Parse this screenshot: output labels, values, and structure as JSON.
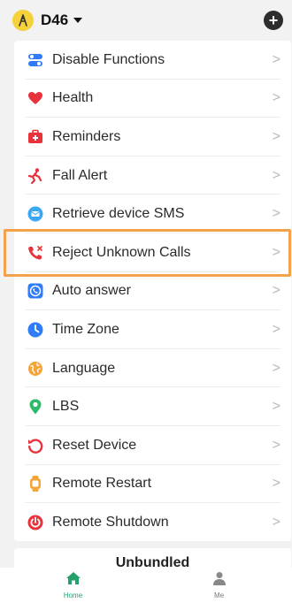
{
  "header": {
    "device_name": "D46",
    "add_label": "+"
  },
  "menu": {
    "items": [
      {
        "label": "Disable Functions",
        "icon": "toggle-icon",
        "color": "#2f7cf6"
      },
      {
        "label": "Health",
        "icon": "heart-icon",
        "color": "#e8323c"
      },
      {
        "label": "Reminders",
        "icon": "first-aid-kit-icon",
        "color": "#e8323c"
      },
      {
        "label": "Fall Alert",
        "icon": "falling-person-icon",
        "color": "#e8323c"
      },
      {
        "label": "Retrieve device SMS",
        "icon": "message-icon",
        "color": "#3aa7f3"
      },
      {
        "label": "Reject Unknown Calls",
        "icon": "reject-call-icon",
        "color": "#e8323c"
      },
      {
        "label": "Auto answer",
        "icon": "auto-answer-icon",
        "color": "#2f7cf6"
      },
      {
        "label": "Time Zone",
        "icon": "clock-icon",
        "color": "#2f7cf6"
      },
      {
        "label": "Language",
        "icon": "globe-icon",
        "color": "#f3a53a"
      },
      {
        "label": "LBS",
        "icon": "location-pin-icon",
        "color": "#2dba6a"
      },
      {
        "label": "Reset Device",
        "icon": "reset-icon",
        "color": "#e8323c"
      },
      {
        "label": "Remote Restart",
        "icon": "watch-icon",
        "color": "#f3a53a"
      },
      {
        "label": "Remote Shutdown",
        "icon": "power-icon",
        "color": "#e8323c"
      }
    ],
    "chevron": ">"
  },
  "unbundled": {
    "label": "Unbundled"
  },
  "nav": {
    "home_label": "Home",
    "me_label": "Me"
  },
  "colors": {
    "accent_green": "#24a06b",
    "highlight": "#f3a14a"
  }
}
